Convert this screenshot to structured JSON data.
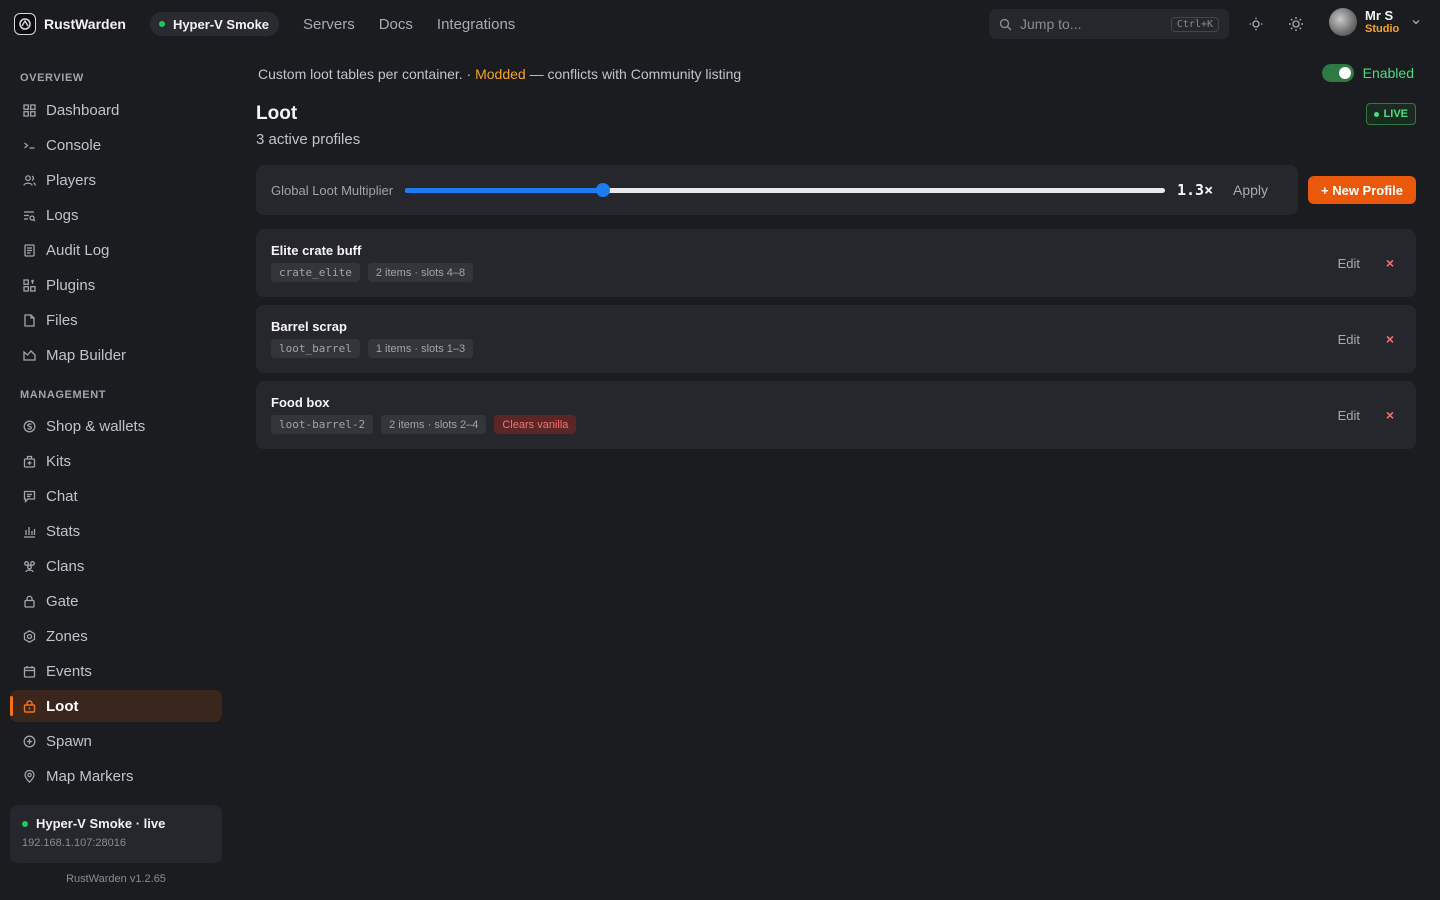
{
  "brand": {
    "name": "RustWarden"
  },
  "server_pill": {
    "label": "Hyper-V Smoke"
  },
  "topnav": [
    {
      "label": "Servers"
    },
    {
      "label": "Docs"
    },
    {
      "label": "Integrations"
    }
  ],
  "search": {
    "placeholder": "Jump to...",
    "shortcut": "Ctrl+K"
  },
  "user": {
    "name": "Mr S",
    "role": "Studio"
  },
  "sidebar": {
    "overview_title": "OVERVIEW",
    "management_title": "MANAGEMENT",
    "overview": [
      {
        "label": "Dashboard",
        "icon": "grid-icon"
      },
      {
        "label": "Console",
        "icon": "terminal-icon"
      },
      {
        "label": "Players",
        "icon": "users-icon"
      },
      {
        "label": "Logs",
        "icon": "list-search-icon"
      },
      {
        "label": "Audit Log",
        "icon": "document-icon"
      },
      {
        "label": "Plugins",
        "icon": "puzzle-icon"
      },
      {
        "label": "Files",
        "icon": "file-icon"
      },
      {
        "label": "Map Builder",
        "icon": "map-icon"
      }
    ],
    "management": [
      {
        "label": "Shop & wallets",
        "icon": "coin-icon"
      },
      {
        "label": "Kits",
        "icon": "kit-icon"
      },
      {
        "label": "Chat",
        "icon": "chat-icon"
      },
      {
        "label": "Stats",
        "icon": "bar-chart-icon"
      },
      {
        "label": "Clans",
        "icon": "group-icon"
      },
      {
        "label": "Gate",
        "icon": "lock-icon"
      },
      {
        "label": "Zones",
        "icon": "zone-icon"
      },
      {
        "label": "Events",
        "icon": "calendar-icon"
      },
      {
        "label": "Loot",
        "icon": "loot-icon",
        "active": true
      },
      {
        "label": "Spawn",
        "icon": "plus-circle-icon"
      },
      {
        "label": "Map Markers",
        "icon": "pin-icon"
      }
    ],
    "server_card": {
      "title": "Hyper-V Smoke · live",
      "address": "192.168.1.107:28016"
    },
    "version": "RustWarden v1.2.65"
  },
  "main": {
    "description_pre": "Custom loot tables per container. · ",
    "description_mod": "Modded",
    "description_post": " — conflicts with Community listing",
    "toggle_label": "Enabled",
    "title": "Loot",
    "subtitle": "3 active profiles",
    "live_badge": "LIVE",
    "multiplier": {
      "label": "Global Loot Multiplier",
      "value": 1.3,
      "min": 0,
      "max": 5,
      "display": "1.3×",
      "apply_label": "Apply"
    },
    "new_profile_label": "+ New Profile",
    "profiles": [
      {
        "name": "Elite crate buff",
        "container": "crate_elite",
        "info": "2 items · slots 4–8",
        "warning": "",
        "edit": "Edit",
        "remove": "×"
      },
      {
        "name": "Barrel scrap",
        "container": "loot_barrel",
        "info": "1 items · slots 1–3",
        "warning": "",
        "edit": "Edit",
        "remove": "×"
      },
      {
        "name": "Food box",
        "container": "loot-barrel-2",
        "info": "2 items · slots 2–4",
        "warning": "Clears vanilla",
        "edit": "Edit",
        "remove": "×"
      }
    ]
  },
  "colors": {
    "accent": "#ea580c",
    "live": "#4ade80",
    "slider": "#1d7cf2",
    "modded": "#f5a524",
    "danger": "#f87171"
  }
}
